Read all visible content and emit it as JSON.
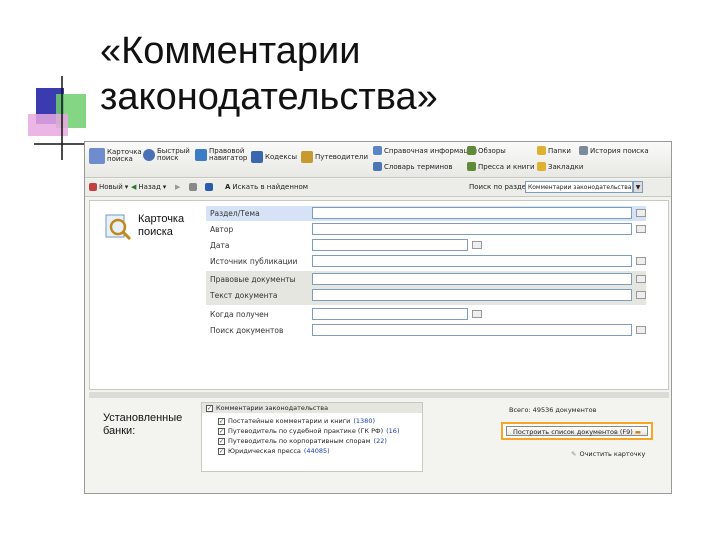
{
  "slide": {
    "title_line1": "«Комментарии",
    "title_line2": "законодательства»"
  },
  "menubar": {
    "items": [
      {
        "label": "Карточка поиска",
        "color": "#6f8ccf"
      },
      {
        "label": "Быстрый поиск",
        "color": "#4a70b8"
      },
      {
        "label": "Правовой навигатор",
        "color": "#3c7cc4"
      },
      {
        "label": "Кодексы",
        "color": "#3a68b0"
      },
      {
        "label": "Путеводители",
        "color": "#c79a2e"
      },
      {
        "label": "Справочная информация",
        "color": "#5a86c8"
      },
      {
        "label": "Обзоры",
        "color": "#5f8a3a"
      },
      {
        "label": "Папки",
        "color": "#e0b030"
      },
      {
        "label": "История поиска",
        "color": "#7a8a9a"
      },
      {
        "label": "Словарь терминов",
        "color": "#4a76b4"
      },
      {
        "label": "Пресса и книги",
        "color": "#5f8a3a"
      },
      {
        "label": "Закладки",
        "color": "#e0b030"
      }
    ]
  },
  "toolbar": {
    "new_label": "Новый",
    "back_label": "Назад",
    "show_all_label": "Искать в найденном",
    "search_by_label": "Поиск по разделу",
    "search_by_value": "Комментарии законодательства"
  },
  "card": {
    "title_line1": "Карточка",
    "title_line2": "поиска",
    "fields": [
      {
        "label": "Раздел/Тема"
      },
      {
        "label": "Автор"
      },
      {
        "label": "Дата"
      },
      {
        "label": "Источник публикации"
      },
      {
        "label": "Правовые документы"
      },
      {
        "label": "Текст документа"
      },
      {
        "label": "Когда получен"
      },
      {
        "label": "Поиск документов"
      }
    ]
  },
  "banks": {
    "title_line1": "Установленные",
    "title_line2": "банки:",
    "header": "Комментарии законодательства",
    "items": [
      {
        "label": "Постатейные комментарии и книги",
        "count": "(1380)"
      },
      {
        "label": "Путеводитель по судебной практике (ГК РФ)",
        "count": "(16)"
      },
      {
        "label": "Путеводитель по корпоративным спорам",
        "count": "(22)"
      },
      {
        "label": "Юридическая пресса",
        "count": "(44085)"
      }
    ]
  },
  "results": {
    "found_text": "Всего: 49536 документов",
    "build_label": "Построить список документов (F9)",
    "clear_label": "Очистить карточку"
  }
}
